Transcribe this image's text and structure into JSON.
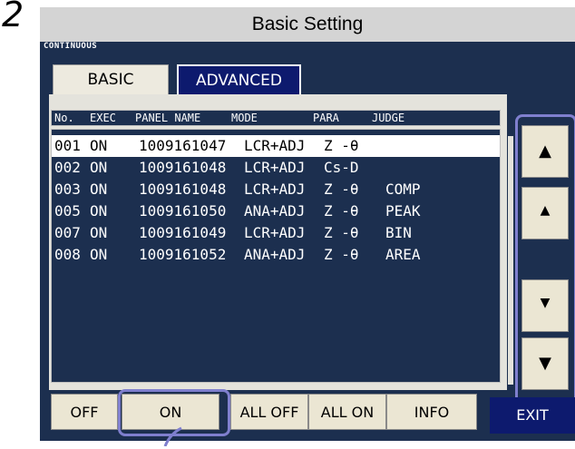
{
  "step_number": "2",
  "header": {
    "title": "Basic Setting"
  },
  "mode_label": "CONTINUOUS",
  "tabs": [
    {
      "label": "BASIC",
      "active": true
    },
    {
      "label": "ADVANCED",
      "active": false
    }
  ],
  "columns": [
    "No.",
    "EXEC",
    "PANEL NAME",
    "MODE",
    "PARA",
    "JUDGE"
  ],
  "rows": [
    {
      "no": "001",
      "exec": "ON",
      "panel": "1009161047",
      "mode": "LCR+ADJ",
      "para": "Z -θ",
      "judge": "",
      "selected": true
    },
    {
      "no": "002",
      "exec": "ON",
      "panel": "1009161048",
      "mode": "LCR+ADJ",
      "para": "Cs-D",
      "judge": ""
    },
    {
      "no": "003",
      "exec": "ON",
      "panel": "1009161048",
      "mode": "LCR+ADJ",
      "para": "Z -θ",
      "judge": "COMP"
    },
    {
      "no": "005",
      "exec": "ON",
      "panel": "1009161050",
      "mode": "ANA+ADJ",
      "para": "Z -θ",
      "judge": "PEAK"
    },
    {
      "no": "007",
      "exec": "ON",
      "panel": "1009161049",
      "mode": "LCR+ADJ",
      "para": "Z -θ",
      "judge": "BIN"
    },
    {
      "no": "008",
      "exec": "ON",
      "panel": "1009161052",
      "mode": "ANA+ADJ",
      "para": "Z -θ",
      "judge": "AREA"
    }
  ],
  "scroll_buttons": [
    {
      "name": "page-up",
      "glyph": "▲"
    },
    {
      "name": "line-up",
      "glyph": "▲"
    },
    {
      "name": "line-down",
      "glyph": "▼"
    },
    {
      "name": "page-down",
      "glyph": "▼"
    }
  ],
  "bottom_buttons": {
    "off": "OFF",
    "on": "ON",
    "all_off": "ALL OFF",
    "all_on": "ALL ON",
    "info": "INFO",
    "exit": "EXIT"
  },
  "colors": {
    "screen_bg": "#1c2f4f",
    "header_bg": "#d4d4d4",
    "button_bg": "#ebe6d3",
    "highlight_frame": "#7f7fce",
    "exit_bg": "#0d1a6e"
  }
}
